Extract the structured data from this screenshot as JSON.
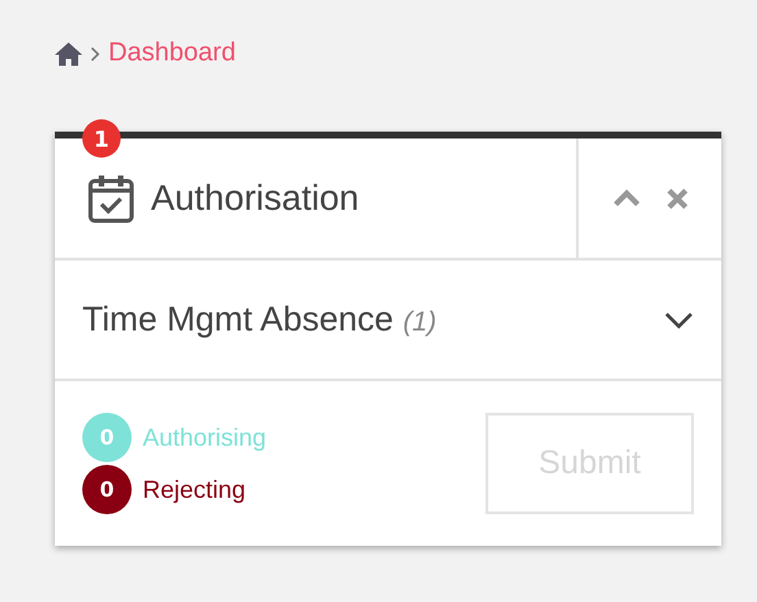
{
  "breadcrumb": {
    "current": "Dashboard"
  },
  "widget": {
    "title": "Authorisation",
    "badge": "1",
    "collapsed": false,
    "sections": [
      {
        "label": "Time Mgmt Absence",
        "count": "(1)",
        "expanded": false
      }
    ],
    "counters": [
      {
        "value": "0",
        "label": "Authorising",
        "color": "#7ee2d8"
      },
      {
        "value": "0",
        "label": "Rejecting",
        "color": "#8a0012"
      }
    ],
    "submit": {
      "label": "Submit",
      "disabled": true
    }
  }
}
